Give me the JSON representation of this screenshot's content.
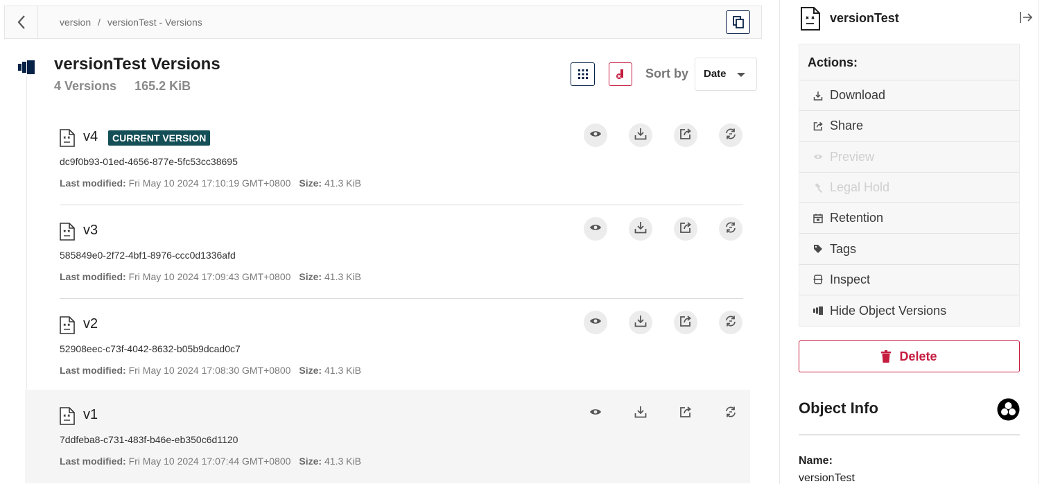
{
  "breadcrumb": {
    "root": "version",
    "separator": "/",
    "current": "versionTest - Versions"
  },
  "header": {
    "title": "versionTest Versions",
    "count": "4 Versions",
    "total_size": "165.2 KiB",
    "sort_label": "Sort by",
    "sort_value": "Date"
  },
  "versions": [
    {
      "name": "v4",
      "badge": "CURRENT VERSION",
      "id": "dc9f0b93-01ed-4656-877e-5fc53cc38695",
      "modified_label": "Last modified:",
      "modified": "Fri May 10 2024 17:10:19 GMT+0800",
      "size_label": "Size:",
      "size": "41.3 KiB"
    },
    {
      "name": "v3",
      "badge": "",
      "id": "585849e0-2f72-4bf1-8976-ccc0d1336afd",
      "modified_label": "Last modified:",
      "modified": "Fri May 10 2024 17:09:43 GMT+0800",
      "size_label": "Size:",
      "size": "41.3 KiB"
    },
    {
      "name": "v2",
      "badge": "",
      "id": "52908eec-c73f-4042-8632-b05b9dcad0c7",
      "modified_label": "Last modified:",
      "modified": "Fri May 10 2024 17:08:30 GMT+0800",
      "size_label": "Size:",
      "size": "41.3 KiB"
    },
    {
      "name": "v1",
      "badge": "",
      "id": "7ddfeba8-c731-483f-b46e-eb350c6d1120",
      "modified_label": "Last modified:",
      "modified": "Fri May 10 2024 17:07:44 GMT+0800",
      "size_label": "Size:",
      "size": "41.3 KiB"
    }
  ],
  "panel": {
    "object_name": "versionTest",
    "actions_title": "Actions:",
    "actions": [
      {
        "label": "Download",
        "icon": "download-icon",
        "disabled": false
      },
      {
        "label": "Share",
        "icon": "share-icon",
        "disabled": false
      },
      {
        "label": "Preview",
        "icon": "eye-icon",
        "disabled": true
      },
      {
        "label": "Legal Hold",
        "icon": "gavel-icon",
        "disabled": true
      },
      {
        "label": "Retention",
        "icon": "calendar-icon",
        "disabled": false
      },
      {
        "label": "Tags",
        "icon": "tag-icon",
        "disabled": false
      },
      {
        "label": "Inspect",
        "icon": "inspect-icon",
        "disabled": false
      },
      {
        "label": "Hide Object Versions",
        "icon": "versions-icon",
        "disabled": false
      }
    ],
    "delete_label": "Delete",
    "info_title": "Object Info",
    "name_label": "Name:",
    "name_value": "versionTest"
  },
  "colors": {
    "navy": "#082146",
    "badge_teal": "#144e57",
    "danger": "#c51b3f"
  }
}
